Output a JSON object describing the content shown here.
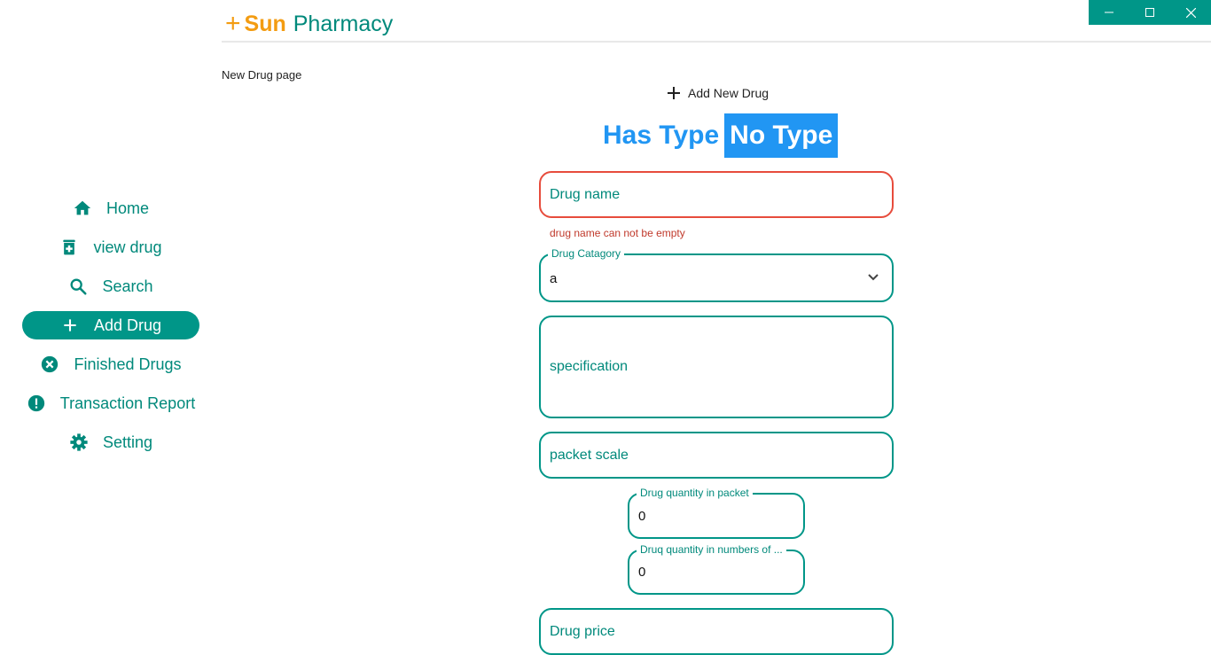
{
  "window": {
    "minimize_icon": "minimize-icon",
    "maximize_icon": "maximize-icon",
    "close_icon": "close-icon",
    "accent": "#009688"
  },
  "header": {
    "plus": "+",
    "brand_bold": "Sun",
    "brand_rest": "Pharmacy"
  },
  "page_label": "New Drug page",
  "sidebar": {
    "items": [
      {
        "label": "Home",
        "icon": "home-icon"
      },
      {
        "label": "view drug",
        "icon": "drug-icon"
      },
      {
        "label": "Search",
        "icon": "search-icon"
      },
      {
        "label": "Add Drug",
        "icon": "plus-icon",
        "active": true
      },
      {
        "label": "Finished Drugs",
        "icon": "cancel-circle-icon"
      },
      {
        "label": "Transaction Report",
        "icon": "alert-circle-icon"
      },
      {
        "label": "Setting",
        "icon": "gear-icon"
      }
    ]
  },
  "main": {
    "add_new_label": "Add New Drug",
    "toggle": {
      "has_type": "Has Type",
      "no_type": "No Type",
      "selected": "No Type"
    },
    "form": {
      "drug_name": {
        "placeholder": "Drug name",
        "error": "drug name can not be empty"
      },
      "category": {
        "label": "Drug Catagory",
        "value": "a"
      },
      "specification": {
        "placeholder": "specification"
      },
      "packet_scale": {
        "placeholder": "packet scale"
      },
      "qty_in_packet": {
        "label": "Drug quantity in packet",
        "value": "0"
      },
      "qty_in_numbers": {
        "label": "Druq quantity in numbers of ...",
        "value": "0"
      },
      "drug_price": {
        "placeholder": "Drug price"
      }
    }
  },
  "colors": {
    "brand_orange": "#f39c12",
    "teal": "#009688",
    "blue": "#2196f3",
    "error": "#e74c3c"
  }
}
